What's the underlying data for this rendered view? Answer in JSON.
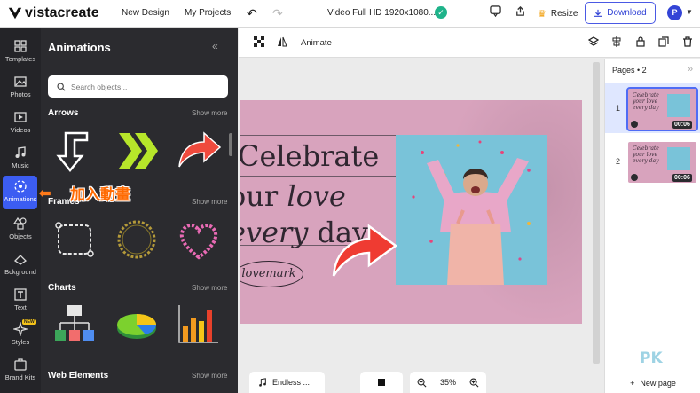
{
  "brand": {
    "name": "vistacreate"
  },
  "topbar": {
    "new_design": "New Design",
    "my_projects": "My Projects",
    "doc_title": "Video Full HD 1920x1080...",
    "resize": "Resize",
    "download": "Download",
    "avatar_letter": "P"
  },
  "rail": {
    "items": [
      {
        "label": "Templates"
      },
      {
        "label": "Photos"
      },
      {
        "label": "Videos"
      },
      {
        "label": "Music"
      },
      {
        "label": "Animations"
      },
      {
        "label": "Objects"
      },
      {
        "label": "Bckground"
      },
      {
        "label": "Text"
      },
      {
        "label": "Styles",
        "badge": "NEW"
      },
      {
        "label": "Brand Kits"
      }
    ],
    "active": "Animations"
  },
  "panel": {
    "title": "Animations",
    "search_placeholder": "Search objects...",
    "sections": [
      {
        "title": "Arrows",
        "show_more": "Show more"
      },
      {
        "title": "Frames",
        "show_more": "Show more"
      },
      {
        "title": "Charts",
        "show_more": "Show more"
      },
      {
        "title": "Web Elements",
        "show_more": "Show more"
      }
    ]
  },
  "annotation": {
    "text": "加入動畫"
  },
  "toolbar": {
    "animate": "Animate"
  },
  "design": {
    "line1": "Celebrate",
    "line2a": "our ",
    "line2b": "love",
    "line3a": "every",
    "line3b": " day",
    "mark": "lovemark"
  },
  "bottom": {
    "music": "Endless ...",
    "zoom": "35%"
  },
  "pages": {
    "title": "Pages • 2",
    "items": [
      {
        "num": "1",
        "thumb_text": "Celebrate your love every day",
        "duration": "00:06"
      },
      {
        "num": "2",
        "thumb_text": "Celebrate your love every day",
        "duration": "00:06"
      }
    ],
    "new_page": "New page"
  },
  "watermark": "PK",
  "colors": {
    "accent": "#3c5df2",
    "design_bg": "#d8a3bd",
    "photo_bg": "#79c3d9",
    "annotation": "#ff6a00"
  }
}
